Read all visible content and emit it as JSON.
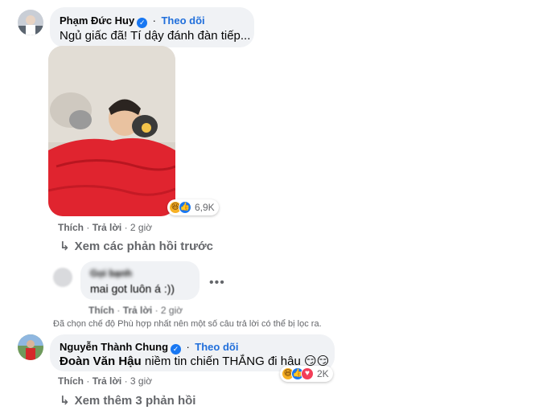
{
  "comment1": {
    "author": "Phạm Đức Huy",
    "verified_icon": "verified-badge-icon",
    "follow": "Theo dõi",
    "text": "Ngủ giấc đã! Tí dậy đánh đàn tiếp...",
    "reaction_count": "6,9K",
    "actions": {
      "like": "Thích",
      "reply": "Trả lời",
      "time": "2 giờ"
    },
    "view_previous": "Xem các phản hồi trước"
  },
  "reply1": {
    "author": "Gọi bạnh",
    "text": "mai got luôn á :))",
    "actions": {
      "like": "Thích",
      "reply": "Trả lời",
      "time": "2 giờ"
    }
  },
  "filter_notice": "Đã chọn chế độ Phù hợp nhất nên một số câu trả lời có thể bị lọc ra.",
  "comment2": {
    "author": "Nguyễn Thành Chung",
    "follow": "Theo dõi",
    "mention": "Đoàn Văn Hậu",
    "text": " niềm tin chiến THẮNG đi hậu 😏😏",
    "reaction_count": "2K",
    "actions": {
      "like": "Thích",
      "reply": "Trả lời",
      "time": "3 giờ"
    },
    "view_more": "Xem thêm 3 phản hồi"
  },
  "colors": {
    "accent": "#216fdb",
    "bubble": "#f0f2f5",
    "muted": "#65676b"
  }
}
